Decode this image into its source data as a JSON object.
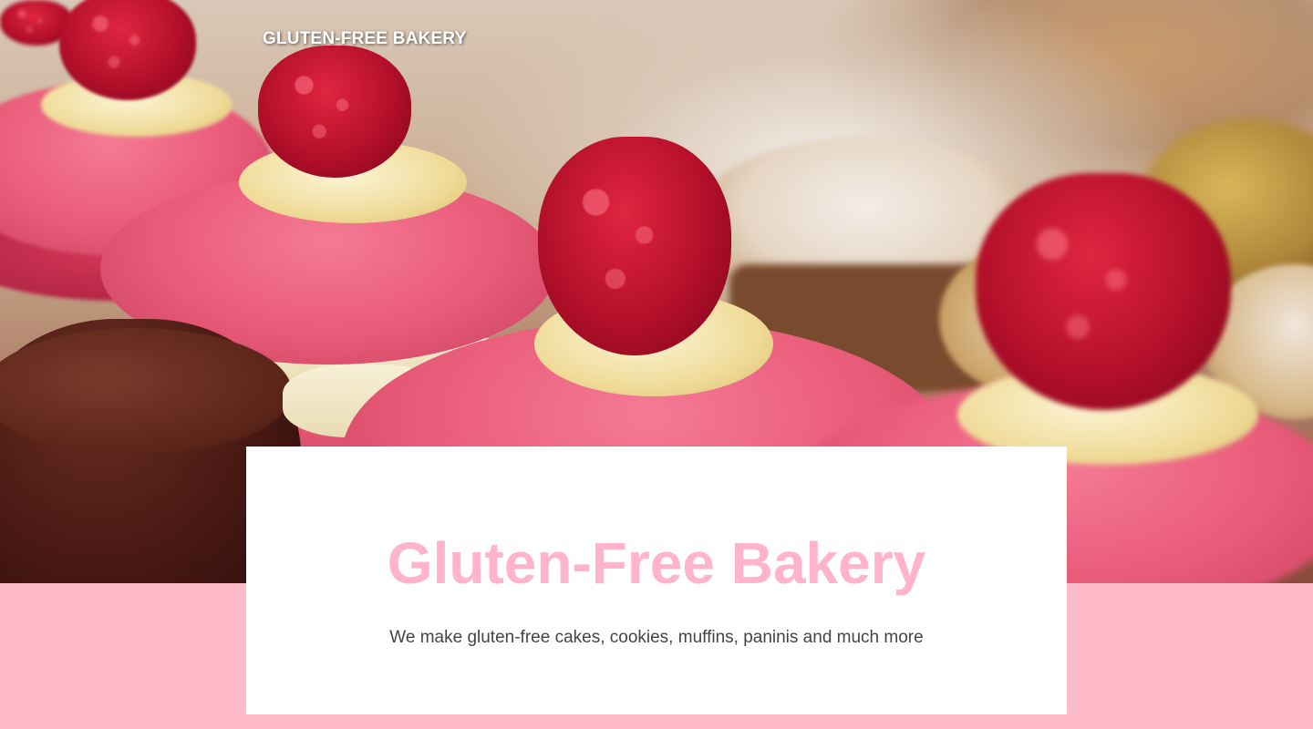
{
  "header": {
    "brand_label": "GLUTEN-FREE BAKERY"
  },
  "hero": {
    "image_description_icon": "photo-macarons"
  },
  "card": {
    "title": "Gluten-Free Bakery",
    "subtitle": "We make gluten-free cakes, cookies, muffins, paninis and much more"
  },
  "colors": {
    "accent_pink": "#ffbbc7",
    "title_pink": "#ffb3cc",
    "card_bg": "#ffffff",
    "text_gray": "#444444"
  }
}
